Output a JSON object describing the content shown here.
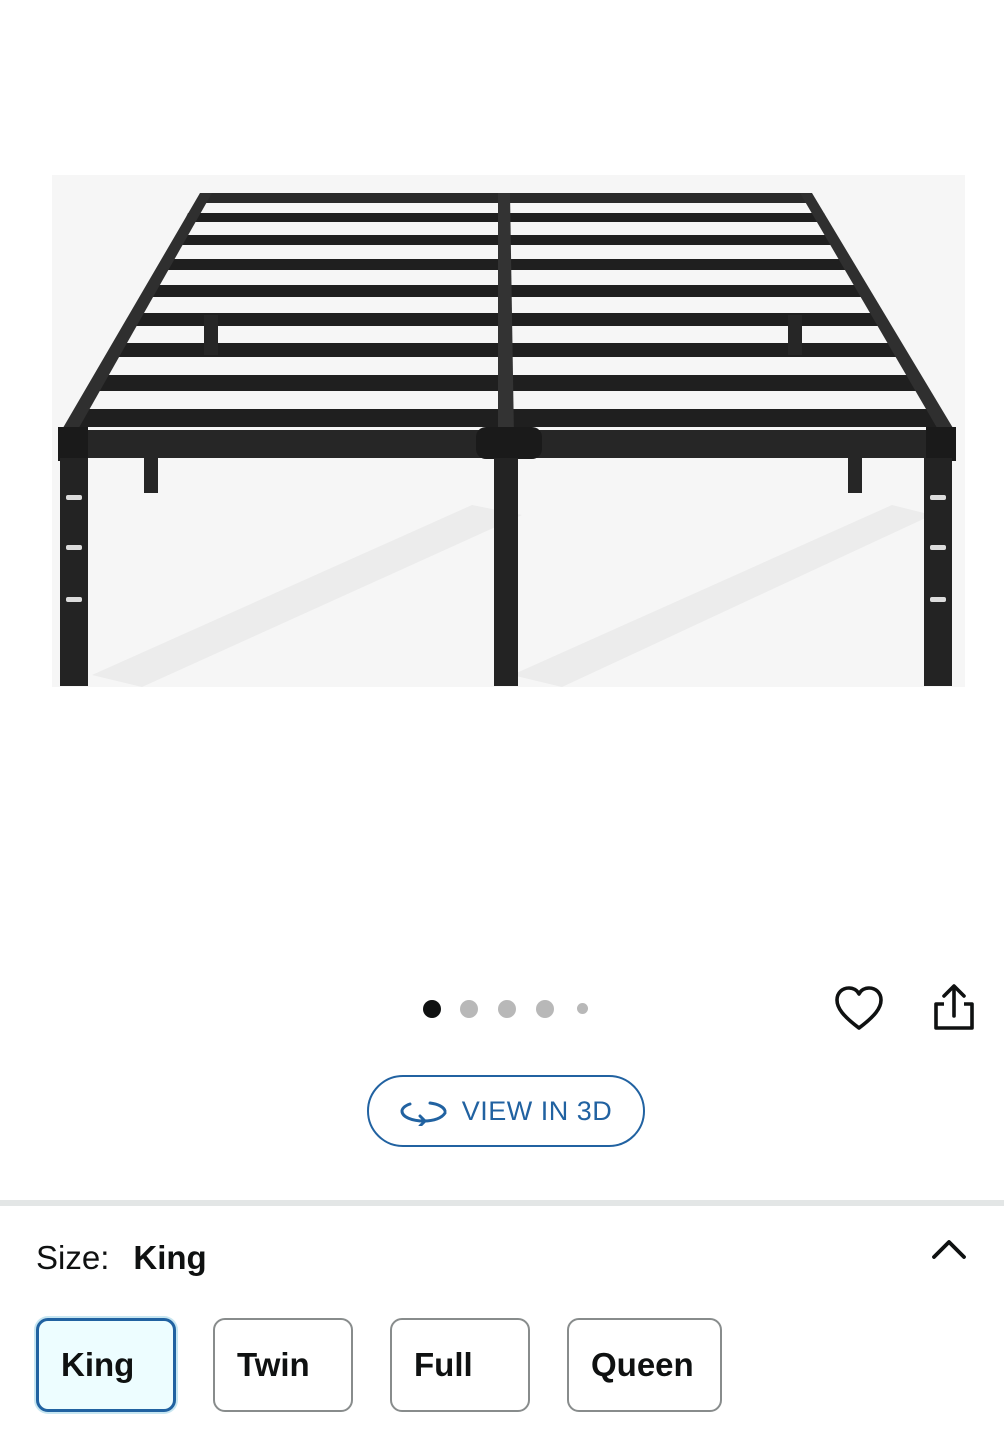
{
  "product": {
    "image_alt": "Black metal platform bed frame"
  },
  "carousel": {
    "total": 5,
    "active_index": 0
  },
  "view3d": {
    "label": "VIEW IN 3D"
  },
  "size": {
    "label": "Size:",
    "selected": "King",
    "options": [
      "King",
      "Twin",
      "Full",
      "Queen"
    ]
  },
  "icons": {
    "favorite": "heart-icon",
    "share": "share-icon",
    "collapse": "chevron-up-icon",
    "view3d": "rotate-3d-icon"
  },
  "colors": {
    "accent": "#2162a1",
    "selected_bg": "#edfdff",
    "text": "#0f1111",
    "divider": "#e3e6e6"
  }
}
